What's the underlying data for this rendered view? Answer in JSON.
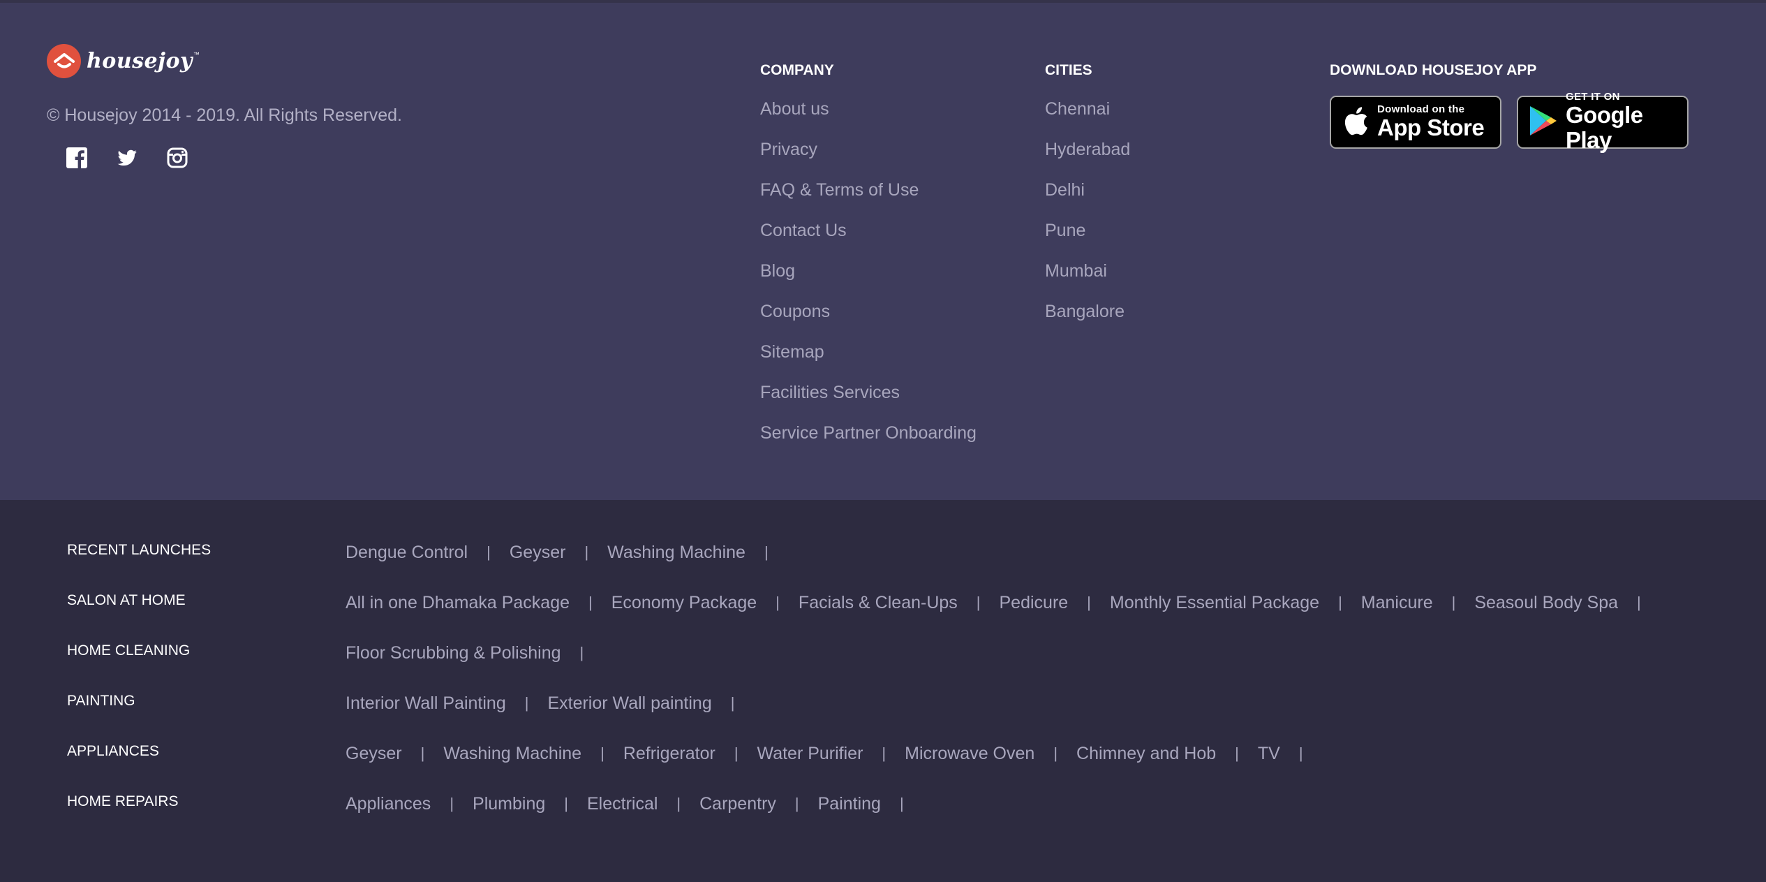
{
  "brand": {
    "name": "housejoy",
    "tm": "™",
    "copyright": "© Housejoy 2014 - 2019. All Rights Reserved.",
    "accent_color": "#e0513e"
  },
  "social": [
    {
      "icon": "facebook-icon"
    },
    {
      "icon": "twitter-icon"
    },
    {
      "icon": "instagram-icon"
    }
  ],
  "company": {
    "title": "COMPANY",
    "items": [
      "About us",
      "Privacy",
      "FAQ & Terms of Use",
      "Contact Us",
      "Blog",
      "Coupons",
      "Sitemap",
      "Facilities Services",
      "Service Partner Onboarding"
    ]
  },
  "cities": {
    "title": "CITIES",
    "items": [
      "Chennai",
      "Hyderabad",
      "Delhi",
      "Pune",
      "Mumbai",
      "Bangalore"
    ]
  },
  "app": {
    "title": "DOWNLOAD HOUSEJOY APP",
    "appstore": {
      "small": "Download on the",
      "big": "App Store",
      "icon": "apple-icon"
    },
    "googleplay": {
      "small": "GET IT ON",
      "big": "Google Play",
      "icon": "google-play-icon"
    }
  },
  "categories": [
    {
      "title": "RECENT LAUNCHES",
      "items": [
        "Dengue Control",
        "Geyser",
        "Washing Machine"
      ]
    },
    {
      "title": "SALON AT HOME",
      "items": [
        "All in one Dhamaka Package",
        "Economy Package",
        "Facials & Clean-Ups",
        "Pedicure",
        "Monthly Essential Package",
        "Manicure",
        "Seasoul Body Spa"
      ]
    },
    {
      "title": "HOME CLEANING",
      "items": [
        "Floor Scrubbing & Polishing"
      ]
    },
    {
      "title": "PAINTING",
      "items": [
        "Interior Wall Painting",
        "Exterior Wall painting"
      ]
    },
    {
      "title": "APPLIANCES",
      "items": [
        "Geyser",
        "Washing Machine",
        "Refrigerator",
        "Water Purifier",
        "Microwave Oven",
        "Chimney and Hob",
        "TV"
      ]
    },
    {
      "title": "HOME REPAIRS",
      "items": [
        "Appliances",
        "Plumbing",
        "Electrical",
        "Carpentry",
        "Painting"
      ]
    }
  ],
  "separator": "|"
}
